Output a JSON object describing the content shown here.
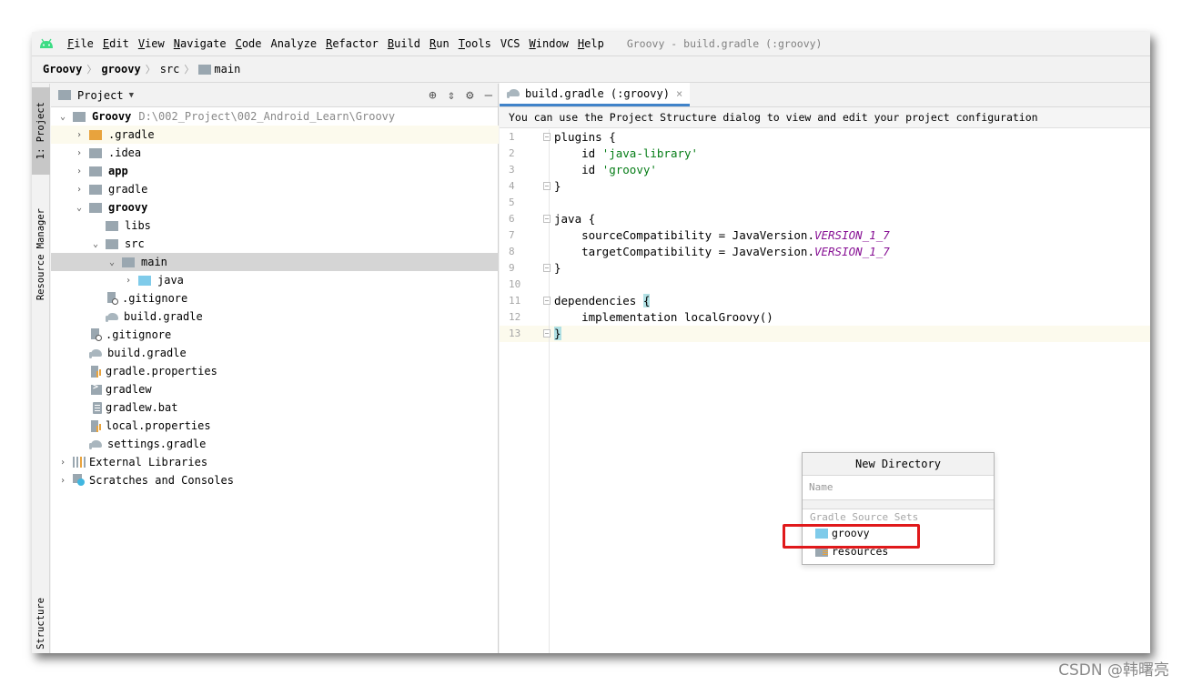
{
  "menubar": {
    "items": [
      {
        "u": "F",
        "rest": "ile"
      },
      {
        "u": "E",
        "rest": "dit"
      },
      {
        "u": "V",
        "rest": "iew"
      },
      {
        "u": "N",
        "rest": "avigate"
      },
      {
        "u": "C",
        "rest": "ode"
      },
      {
        "u": "",
        "rest": "Analyze"
      },
      {
        "u": "R",
        "rest": "efactor"
      },
      {
        "u": "B",
        "rest": "uild"
      },
      {
        "u": "R",
        "rest": "un"
      },
      {
        "u": "T",
        "rest": "ools"
      },
      {
        "u": "",
        "rest": "VCS"
      },
      {
        "u": "W",
        "rest": "indow"
      },
      {
        "u": "H",
        "rest": "elp"
      }
    ],
    "window_title": "Groovy - build.gradle (:groovy)"
  },
  "breadcrumb": {
    "items": [
      "Groovy",
      "groovy",
      "src",
      "main"
    ]
  },
  "leftstrip": {
    "project_tab": "1: Project",
    "resource_tab": "Resource Manager",
    "structure_tab": "Structure"
  },
  "project_panel": {
    "title": "Project",
    "tree": [
      {
        "label": "Groovy",
        "path": "D:\\002_Project\\002_Android_Learn\\Groovy"
      },
      {
        "label": ".gradle"
      },
      {
        "label": ".idea"
      },
      {
        "label": "app"
      },
      {
        "label": "gradle"
      },
      {
        "label": "groovy"
      },
      {
        "label": "libs"
      },
      {
        "label": "src"
      },
      {
        "label": "main"
      },
      {
        "label": "java"
      },
      {
        "label": ".gitignore"
      },
      {
        "label": "build.gradle"
      },
      {
        "label": ".gitignore"
      },
      {
        "label": "build.gradle"
      },
      {
        "label": "gradle.properties"
      },
      {
        "label": "gradlew"
      },
      {
        "label": "gradlew.bat"
      },
      {
        "label": "local.properties"
      },
      {
        "label": "settings.gradle"
      },
      {
        "label": "External Libraries"
      },
      {
        "label": "Scratches and Consoles"
      }
    ]
  },
  "editor": {
    "tab_label": "build.gradle (:groovy)",
    "notification": "You can use the Project Structure dialog to view and edit your project configuration",
    "line_numbers": [
      "1",
      "2",
      "3",
      "4",
      "5",
      "6",
      "7",
      "8",
      "9",
      "10",
      "11",
      "12",
      "13"
    ],
    "code": {
      "l1": "plugins {",
      "l2_kw": "    id ",
      "l2_str": "'java-library'",
      "l3_kw": "    id ",
      "l3_str": "'groovy'",
      "l4": "}",
      "l6": "java {",
      "l7_a": "    sourceCompatibility = JavaVersion.",
      "l7_c": "VERSION_1_7",
      "l8_a": "    targetCompatibility = JavaVersion.",
      "l8_c": "VERSION_1_7",
      "l9": "}",
      "l11_a": "dependencies ",
      "l11_b": "{",
      "l12": "    implementation localGroovy()",
      "l13": "}"
    }
  },
  "popup": {
    "title": "New Directory",
    "input_placeholder": "Name",
    "group_label": "Gradle Source Sets",
    "items": [
      "groovy",
      "resources"
    ]
  },
  "watermark": "CSDN @韩曙亮",
  "colors": {
    "accent": "#4083c9",
    "highlight_box": "#e0191b",
    "string": "#067d17",
    "constant": "#871094"
  }
}
